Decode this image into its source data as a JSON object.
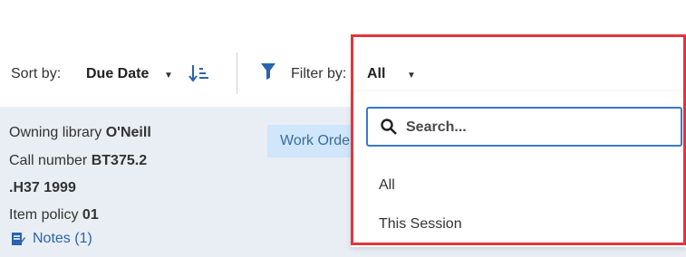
{
  "toolbar": {
    "sort_label": "Sort by:",
    "sort_value": "Due Date",
    "filter_label": "Filter by:",
    "filter_value": "All"
  },
  "item": {
    "owning_library_label": "Owning library",
    "owning_library_value": "O'Neill",
    "call_number_label": "Call number",
    "call_number_value_1": "BT375.2",
    "call_number_value_2": ".H37 1999",
    "item_policy_label": "Item policy",
    "item_policy_value": "01",
    "notes_label": "Notes (1)",
    "work_order_label": "Work Order"
  },
  "filter_dropdown": {
    "search_placeholder": "Search...",
    "options": [
      "All",
      "This Session"
    ]
  },
  "colors": {
    "highlight_border": "#e0363b",
    "accent_blue": "#2a63b0",
    "row_background": "#e8eef3"
  }
}
